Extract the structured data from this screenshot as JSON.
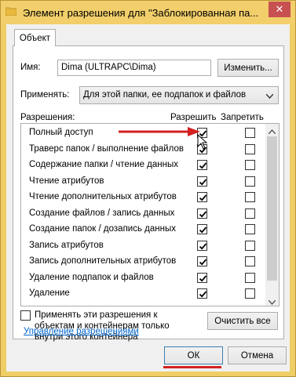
{
  "window": {
    "title": "Элемент разрешения для \"Заблокированная па...",
    "close_glyph": "✕",
    "accent": "#f0ce66",
    "close_color": "#c75050"
  },
  "tabs": [
    {
      "label": "Объект"
    }
  ],
  "principal": {
    "label": "Имя:",
    "value": "Dima (ULTRAPC\\Dima)",
    "change_button": "Изменить..."
  },
  "applies_to": {
    "label": "Применять:",
    "selected": "Для этой папки, ее подпапок и файлов"
  },
  "permissions": {
    "header_label": "Разрешения:",
    "allow_header": "Разрешить",
    "deny_header": "Запретить",
    "rows": [
      {
        "name": "Полный доступ",
        "allow": true,
        "deny": false
      },
      {
        "name": "Траверс папок / выполнение файлов",
        "allow": true,
        "deny": false
      },
      {
        "name": "Содержание папки / чтение данных",
        "allow": true,
        "deny": false
      },
      {
        "name": "Чтение атрибутов",
        "allow": true,
        "deny": false
      },
      {
        "name": "Чтение дополнительных атрибутов",
        "allow": true,
        "deny": false
      },
      {
        "name": "Создание файлов / запись данных",
        "allow": true,
        "deny": false
      },
      {
        "name": "Создание папок / дозапись данных",
        "allow": true,
        "deny": false
      },
      {
        "name": "Запись атрибутов",
        "allow": true,
        "deny": false
      },
      {
        "name": "Запись дополнительных атрибутов",
        "allow": true,
        "deny": false
      },
      {
        "name": "Удаление подпапок и файлов",
        "allow": true,
        "deny": false
      },
      {
        "name": "Удаление",
        "allow": true,
        "deny": false
      }
    ]
  },
  "apply_inherit": {
    "checked": false,
    "text": "Применять эти разрешения к объектам и контейнерам только внутри этого контейнера"
  },
  "clear_all_button": "Очистить все",
  "manage_link": "Управление разрешениями",
  "ok_button": "ОК",
  "cancel_button": "Отмена",
  "annotation_color": "#d42020"
}
